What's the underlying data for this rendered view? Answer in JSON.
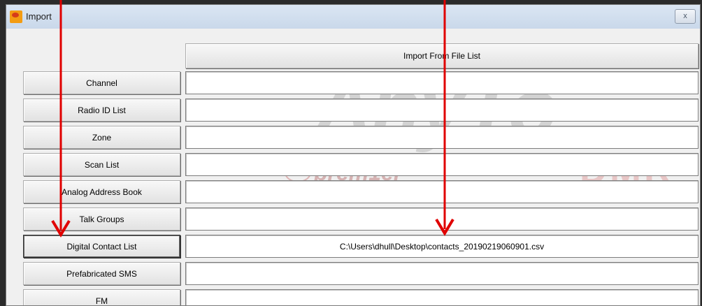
{
  "window": {
    "title": "Import",
    "close_glyph": "x"
  },
  "import_from_file_list_label": "Import From File List",
  "rows": [
    {
      "label": "Channel",
      "path": ""
    },
    {
      "label": "Radio ID List",
      "path": ""
    },
    {
      "label": "Zone",
      "path": ""
    },
    {
      "label": "Scan List",
      "path": ""
    },
    {
      "label": "Analog Address Book",
      "path": ""
    },
    {
      "label": "Talk Groups",
      "path": ""
    },
    {
      "label": "Digital Contact List",
      "path": "C:\\Users\\dhull\\Desktop\\contacts_20190219060901.csv"
    },
    {
      "label": "Prefabricated SMS",
      "path": ""
    },
    {
      "label": "FM",
      "path": ""
    }
  ],
  "watermark": {
    "brand": "AnyTo",
    "subbrand": "DMR",
    "dealer": "prem1er"
  },
  "colors": {
    "annotation_arrow": "#e00000",
    "titlebar": "#c9d8ea"
  },
  "icons": [
    "app-icon",
    "close-icon"
  ]
}
